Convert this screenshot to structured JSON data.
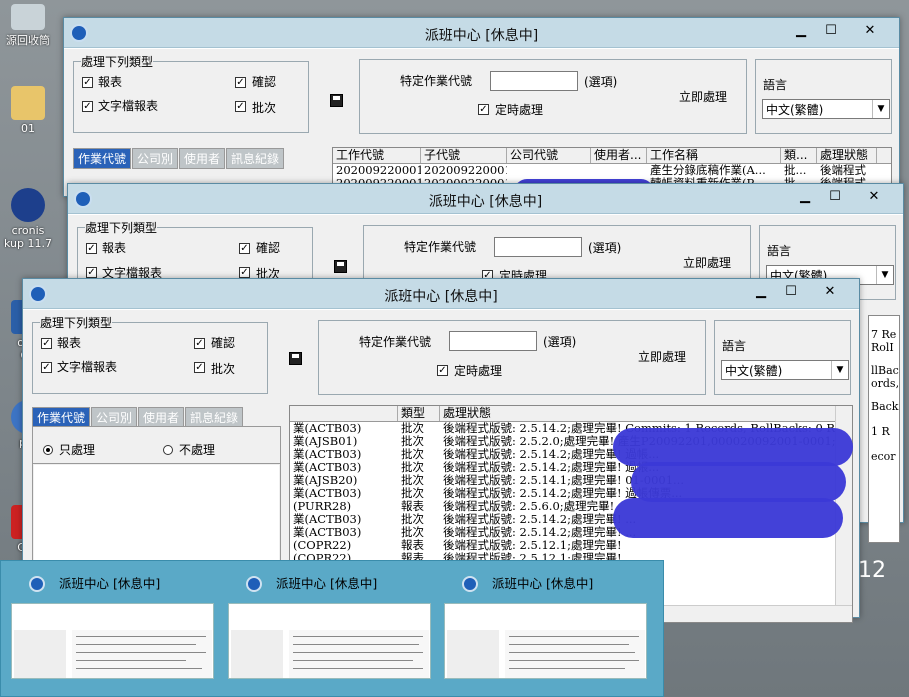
{
  "desktop": {
    "icons": [
      {
        "label": "源回收筒"
      },
      {
        "label": "01"
      },
      {
        "label": "cronis\nkup 11.7"
      },
      {
        "label": "orkf\nGP"
      },
      {
        "label": "pat"
      },
      {
        "label": "C Vi"
      }
    ],
    "clock_fragment": "12"
  },
  "app": {
    "title": "派班中心  [休息中]",
    "controls": {
      "minimize": "▁",
      "maximize": "☐",
      "close": "✕"
    },
    "group_title": "處理下列類型",
    "checkbox_report": "報表",
    "checkbox_text_report": "文字檔報表",
    "checkbox_confirm": "確認",
    "checkbox_batch": "批次",
    "specific_code_label": "特定作業代號",
    "optional_label": "(選項)",
    "timed_label": "定時處理",
    "process_now": "立即處理",
    "language_label": "語言",
    "language_value": "中文(繁體)",
    "tabs": [
      "作業代號",
      "公司別",
      "使用者",
      "訊息紀錄"
    ],
    "radio_only": "只處理",
    "radio_not": "不處理"
  },
  "win1_grid": {
    "headers": [
      "工作代號",
      "子代號",
      "公司代號",
      "使用者...",
      "工作名稱",
      "類...",
      "處理狀態"
    ],
    "rows": [
      [
        "202009220001 24",
        "202009220001",
        "",
        "",
        "產生分錄底稿作業(A...",
        "批...",
        "後端程式"
      ],
      [
        "202009220001 20",
        "202009220001",
        "",
        "",
        "轉帳資料重新作業(P...",
        "批...",
        "後端程式"
      ]
    ]
  },
  "win3_grid": {
    "headers": [
      "",
      "類型",
      "處理狀態"
    ],
    "rows": [
      [
        "業(ACTB03)",
        "批次",
        "後端程式版號: 2.5.14.2;處理完畢! Commits: 1 Records, RollBacks: 0 Records;"
      ],
      [
        "業(AJSB01)",
        "批次",
        "後端程式版號: 2.5.2.0;處理完畢! 產生P20092201,000020092001-0001;"
      ],
      [
        "業(ACTB03)",
        "批次",
        "後端程式版號: 2.5.14.2;處理完畢! 過帳..."
      ],
      [
        "業(ACTB03)",
        "批次",
        "後端程式版號: 2.5.14.2;處理完畢! 過帳..."
      ],
      [
        "業(AJSB20)",
        "批次",
        "後端程式版號: 2.5.14.1;處理完畢! 01-0001..."
      ],
      [
        "業(ACTB03)",
        "批次",
        "後端程式版號: 2.5.14.2;處理完畢! 過帳傳票..."
      ],
      [
        "(PURR28)",
        "報表",
        "後端程式版號: 2.5.6.0;處理完畢!"
      ],
      [
        "業(ACTB03)",
        "批次",
        "後端程式版號: 2.5.14.2;處理完畢! ..."
      ],
      [
        "業(ACTB03)",
        "批次",
        "後端程式版號: 2.5.14.2;處理完畢! ..."
      ],
      [
        "(COPR22)",
        "報表",
        "後端程式版號: 2.5.12.1;處理完畢!"
      ],
      [
        "(COPR22)",
        "報表",
        "後端程式版號: 2.5.12.1;處理完畢!"
      ]
    ]
  },
  "side_fragments": [
    "7 Re",
    "RolI",
    "llBac",
    "ords,",
    "Back",
    "1 R",
    "ecor"
  ],
  "thumbnails": [
    {
      "title": "派班中心  [休息中]"
    },
    {
      "title": "派班中心  [休息中]"
    },
    {
      "title": "派班中心  [休息中]"
    }
  ],
  "colors": {
    "title_bar": "#c5dbe6",
    "tab_active": "#2a62b8",
    "redaction": "#3b39d6",
    "taskbar_preview": "#5aa9c7"
  }
}
